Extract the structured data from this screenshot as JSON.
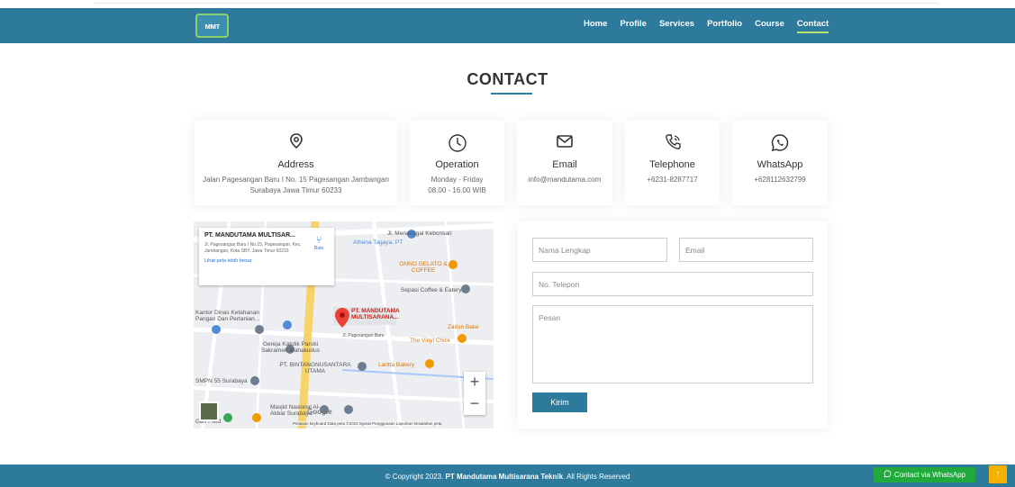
{
  "nav": {
    "logo_text": "ᴍᴍᴛ",
    "items": [
      {
        "label": "Home"
      },
      {
        "label": "Profile"
      },
      {
        "label": "Services"
      },
      {
        "label": "Portfolio"
      },
      {
        "label": "Course"
      },
      {
        "label": "Contact"
      }
    ],
    "active": "Contact"
  },
  "page_title": "CONTACT",
  "cards": [
    {
      "icon": "map-pin-icon",
      "title": "Address",
      "body1": "Jalan Pagesangan Baru I No. 15 Pagesangan Jambangan",
      "body2": "Surabaya Jawa Timur 60233"
    },
    {
      "icon": "clock-icon",
      "title": "Operation",
      "body1": "Monday - Friday",
      "body2": "08.00 - 16.00 WIB"
    },
    {
      "icon": "envelope-icon",
      "title": "Email",
      "body1": "info@mandutama.com",
      "body2": ""
    },
    {
      "icon": "phone-icon",
      "title": "Telephone",
      "body1": "+6231-8287717",
      "body2": ""
    },
    {
      "icon": "whatsapp-icon",
      "title": "WhatsApp",
      "body1": "+628112632799",
      "body2": ""
    }
  ],
  "map": {
    "info_title": "PT. MANDUTAMA MULTISAR...",
    "info_address": "Jl. Pagesangan Baru I No.15, Pagesangan, Kec. Jambangan, Kota SBY, Jawa Timur 60233",
    "info_link": "Lihat peta lebih besar",
    "route_label": "Rute",
    "pin_label": "PT. MANDUTAMA MULTISARANA...",
    "labels": {
      "athena": "Athena Tagaya. PT",
      "onno": "ONNO GELATO & COFFEE",
      "sepasi": "Sepasi Coffee & Eatery",
      "kantor": "Kantor Dinas Ketahanan Pangan Dan Pertanian...",
      "zaitun": "Zaitun Bake",
      "gereja": "Gereja Katolik Paroki Sakramen Mahakudus",
      "vinyl": "The Vinyl Chick",
      "bintang": "PT. BINTANGNUSANTARA UTAMA",
      "laritta": "Laritta Bakery",
      "smpn": "SMPN 55 Surabaya",
      "masjid": "Masjid Nasional Al-Akbar Surabaya",
      "field": "Gan Field",
      "road1": "Jl. Menanggal Kebonsari",
      "road2": "Jl. Pagesangan Baru"
    },
    "google": "Google",
    "footer": "Pintasan keyboard   Data peta ©2023   Syarat Penggunaan   Laporkan kesalahan peta"
  },
  "form": {
    "name_placeholder": "Nama Lengkap",
    "email_placeholder": "Email",
    "phone_placeholder": "No. Telepon",
    "message_placeholder": "Pesan",
    "submit_label": "Kirim"
  },
  "footer": {
    "copyright_prefix": "© Copyright 2023.",
    "company": "PT Mandutama Multisarana Teknik",
    "suffix": ". All Rights Reserved"
  },
  "whatsapp_button": "Contact via WhatsApp",
  "scroll_top_icon": "arrow-up-icon",
  "colors": {
    "primary": "#2d7a9d",
    "accent": "#b8e36a",
    "whatsapp": "#1faa3b",
    "scroll_top": "#f5b100"
  }
}
